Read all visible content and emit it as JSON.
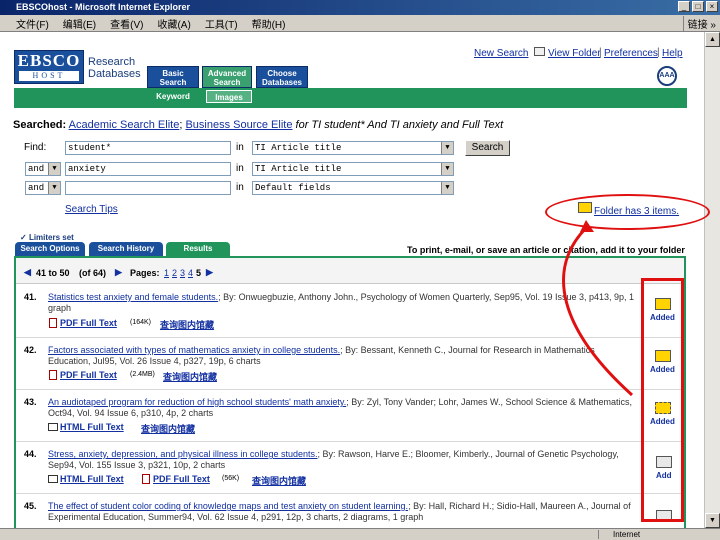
{
  "window": {
    "title": "EBSCOhost - Microsoft Internet Explorer",
    "min": "_",
    "max": "□",
    "close": "×"
  },
  "menu": {
    "items": [
      "文件(F)",
      "编辑(E)",
      "查看(V)",
      "收藏(A)",
      "工具(T)",
      "帮助(H)"
    ],
    "links": "链接 »"
  },
  "status": {
    "zone": "Internet"
  },
  "header": {
    "logo_main": "EBSCO",
    "logo_sub": "HOST",
    "research": "Research",
    "databases": "Databases",
    "tabs": [
      "Basic Search",
      "Advanced Search",
      "Choose Databases"
    ],
    "subtabs": [
      "Keyword",
      "Images"
    ],
    "links": {
      "new_search": "New Search",
      "view_folder": "View Folder",
      "preferences": "Preferences",
      "help": "Help"
    },
    "globe": "AAA"
  },
  "search": {
    "searched_label": "Searched:",
    "db1": "Academic Search Elite",
    "sep": ";",
    "db2": "Business Source Elite",
    "query": "for TI student* And TI anxiety and Full Text",
    "find_label": "Find:",
    "rows": [
      {
        "op": "",
        "term": "student*",
        "in": "in",
        "field": "TI Article title"
      },
      {
        "op": "and",
        "term": "anxiety",
        "in": "in",
        "field": "TI Article title"
      },
      {
        "op": "and",
        "term": "",
        "in": "in",
        "field": "Default fields"
      }
    ],
    "search_button": "Search",
    "tips": "Search Tips"
  },
  "folder": {
    "text": "Folder has 3 items."
  },
  "limiters": "Limiters set",
  "results_tabs": [
    "Search Options",
    "Search History",
    "Results"
  ],
  "print_note": "To print, e-mail, or save an article or citation, add it to your folder",
  "pagination": {
    "range": "41 to 50",
    "of": "(of 64)",
    "pages_label": "Pages:",
    "pages": [
      "1",
      "2",
      "3",
      "4",
      "5"
    ]
  },
  "results": [
    {
      "num": "41.",
      "title": "Statistics test anxiety and female students.",
      "rest": "; By: Onwuegbuzie, Anthony John., Psychology of Women Quarterly, Sep95, Vol. 19 Issue 3, p413, 9p, 1 graph",
      "line2": "",
      "links": [
        {
          "type": "pdf",
          "label": "PDF Full Text",
          "size": "(164K)"
        }
      ],
      "lib": "查询图内馆藏",
      "folder": "Added",
      "state": "added"
    },
    {
      "num": "42.",
      "title": "Factors associated with types of mathematics anxiety in college students.",
      "rest": "; By: Bessant, Kenneth C., Journal for Research in Mathematics Education, Jul95, Vol. 26 Issue 4, p327, 19p, 6 charts",
      "line2": "",
      "links": [
        {
          "type": "pdf",
          "label": "PDF Full Text",
          "size": "(2.4MB)"
        }
      ],
      "lib": "查询图内馆藏",
      "folder": "Added",
      "state": "added"
    },
    {
      "num": "43.",
      "title": "An audiotaped program for reduction of high school students' math anxiety.",
      "rest": "; By: Zyl, Tony Vander; Lohr, James W., School Science & Mathematics, Oct94, Vol. 94 Issue 6, p310, 4p, 2 charts",
      "line2": "",
      "links": [
        {
          "type": "html",
          "label": "HTML Full Text",
          "size": ""
        }
      ],
      "lib": "查询图内馆藏",
      "folder": "Added",
      "state": "added"
    },
    {
      "num": "44.",
      "title": "Stress, anxiety, depression, and physical illness in college students.",
      "rest": "; By: Rawson, Harve E.; Bloomer, Kimberly., Journal of Genetic Psychology, Sep94, Vol. 155 Issue 3, p321, 10p, 2 charts",
      "line2": "",
      "links": [
        {
          "type": "html",
          "label": "HTML Full Text",
          "size": ""
        },
        {
          "type": "pdf",
          "label": "PDF Full Text",
          "size": "(56K)"
        }
      ],
      "lib": "查询图内馆藏",
      "folder": "Add",
      "state": "add"
    },
    {
      "num": "45.",
      "title": "The effect of student color coding of knowledge maps and test anxiety on student learning.",
      "rest": "; By: Hall, Richard H.; Sidio-Hall, Maureen A., Journal of Experimental Education, Summer94, Vol. 62 Issue 4, p291, 12p, 3 charts, 2 diagrams, 1 graph",
      "line2": "",
      "links": [],
      "lib": "",
      "folder": "",
      "state": "add"
    }
  ]
}
